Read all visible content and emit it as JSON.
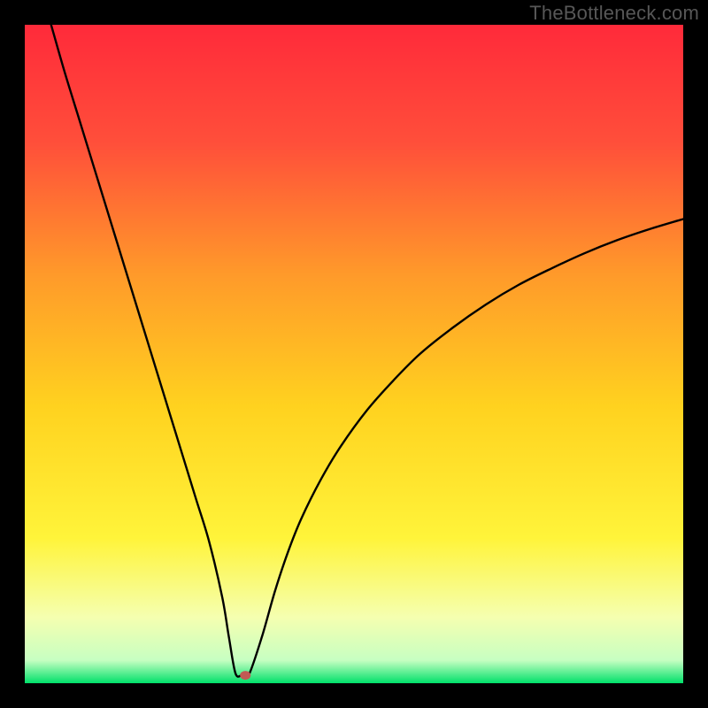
{
  "watermark": "TheBottleneck.com",
  "chart_data": {
    "type": "line",
    "title": "",
    "xlabel": "",
    "ylabel": "",
    "xlim": [
      0,
      100
    ],
    "ylim": [
      0,
      100
    ],
    "grid": false,
    "legend": false,
    "series": [
      {
        "name": "curve",
        "x": [
          4,
          6,
          8,
          10,
          12,
          14,
          16,
          18,
          20,
          22,
          24,
          26,
          28,
          30,
          31,
          32,
          33,
          34,
          36,
          38,
          40,
          42,
          45,
          48,
          52,
          56,
          60,
          65,
          70,
          75,
          80,
          85,
          90,
          95,
          100
        ],
        "y": [
          100,
          93,
          86.5,
          80,
          73.5,
          67,
          60.5,
          54,
          47.5,
          41,
          34.5,
          28,
          21.5,
          13,
          7,
          1.5,
          1.2,
          1.2,
          7,
          14,
          20,
          25,
          31,
          36,
          41.5,
          46,
          50,
          54,
          57.5,
          60.5,
          63,
          65.3,
          67.3,
          69,
          70.5
        ]
      }
    ],
    "marker": {
      "x": 33.5,
      "y": 1.2
    },
    "background_gradient": {
      "stops": [
        {
          "offset": 0.0,
          "color": "#ff2a3a"
        },
        {
          "offset": 0.18,
          "color": "#ff4f3a"
        },
        {
          "offset": 0.38,
          "color": "#ff9a2a"
        },
        {
          "offset": 0.58,
          "color": "#ffd21f"
        },
        {
          "offset": 0.78,
          "color": "#fff43a"
        },
        {
          "offset": 0.9,
          "color": "#f5ffb0"
        },
        {
          "offset": 0.965,
          "color": "#c7ffc2"
        },
        {
          "offset": 1.0,
          "color": "#00e06a"
        }
      ]
    }
  }
}
